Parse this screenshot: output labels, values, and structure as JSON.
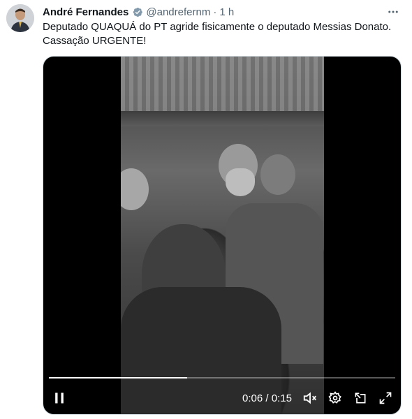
{
  "tweet": {
    "author_name": "André Fernandes",
    "handle": "@andrefernm",
    "separator": "·",
    "time_ago": "1 h",
    "text_line1": "Deputado QUAQUÁ do PT agride fisicamente o deputado Messias Donato.",
    "text_line2": "Cassação URGENTE!"
  },
  "video": {
    "current_time": "0:06",
    "time_sep": " / ",
    "duration": "0:15",
    "progress": 0.4
  },
  "icons": {
    "verified": "verified-badge-icon",
    "more": "more-options-icon",
    "pause": "pause-icon",
    "mute": "volume-muted-icon",
    "settings": "gear-icon",
    "popout": "pop-out-icon",
    "fullscreen": "fullscreen-icon"
  },
  "colors": {
    "verified_blue": "#1d9bf0",
    "secondary_text": "#536471"
  }
}
